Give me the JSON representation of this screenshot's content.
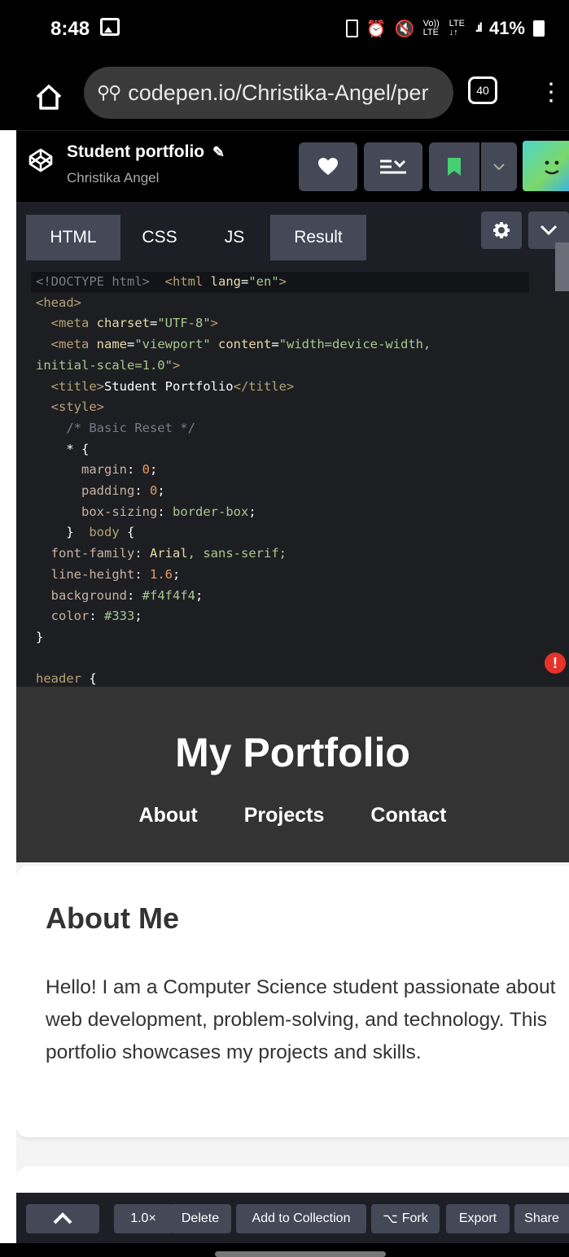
{
  "status": {
    "time": "8:48",
    "battery": "41%",
    "volte": "Vo)) LTE",
    "lte": "LTE ↓↑"
  },
  "browser": {
    "url": "codepen.io/Christika-Angel/per",
    "tab_count": "40"
  },
  "pen": {
    "title": "Student portfolio",
    "author": "Christika Angel"
  },
  "editor": {
    "tabs": [
      "HTML",
      "CSS",
      "JS",
      "Result"
    ],
    "code": {
      "l1a": "<!DOCTYPE html>",
      "l1b": "<html ",
      "l1c": "lang",
      "l1d": "=",
      "l1e": "\"en\"",
      "l1f": ">",
      "l2": "<head>",
      "l3a": "<meta ",
      "l3b": "charset",
      "l3c": "=",
      "l3d": "\"UTF-8\"",
      "l3e": ">",
      "l4a": "<meta ",
      "l4b": "name",
      "l4c": "=",
      "l4d": "\"viewport\"",
      "l4e": "content",
      "l4f": "=",
      "l4g": "\"width=device-width,",
      "l5a": "initial-scale=1.0\"",
      "l5b": ">",
      "l6a": "<title>",
      "l6b": "Student Portfolio",
      "l6c": "</title>",
      "l7": "<style>",
      "l8": "/* Basic Reset */",
      "l9": "* {",
      "l10a": "margin",
      "l10b": ": ",
      "l10c": "0",
      "l10d": ";",
      "l11a": "padding",
      "l11b": ": ",
      "l11c": "0",
      "l11d": ";",
      "l12a": "box-sizing",
      "l12b": ": ",
      "l12c": "border-box",
      "l12d": ";",
      "l13a": "}",
      "l13b": "body",
      "l13c": " {",
      "l14a": "font-family",
      "l14b": ": ",
      "l14c": "Arial",
      "l14d": ", sans-serif;",
      "l15a": "line-height",
      "l15b": ": ",
      "l15c": "1.6",
      "l15d": ";",
      "l16a": "background",
      "l16b": ": ",
      "l16c": "#f4f4f4",
      "l16d": ";",
      "l17a": "color",
      "l17b": ": ",
      "l17c": "#333",
      "l17d": ";",
      "l18": "}",
      "l20a": "header",
      "l20b": " {"
    }
  },
  "preview": {
    "site_title": "My Portfolio",
    "nav": [
      "About",
      "Projects",
      "Contact"
    ],
    "about_heading": "About Me",
    "about_text": "Hello! I am a Computer Science student passionate about web development, problem-solving, and technology. This portfolio showcases my projects and skills."
  },
  "bottom": {
    "zoom": "1.0×",
    "delete": "Delete",
    "add_to_collection": "Add to Collection",
    "fork": "Fork",
    "export": "Export",
    "share": "Share"
  },
  "colors": {
    "editor_bg": "#1d1e22",
    "tab_active": "#444857",
    "header_bg": "#333333",
    "error": "#e5332a"
  }
}
